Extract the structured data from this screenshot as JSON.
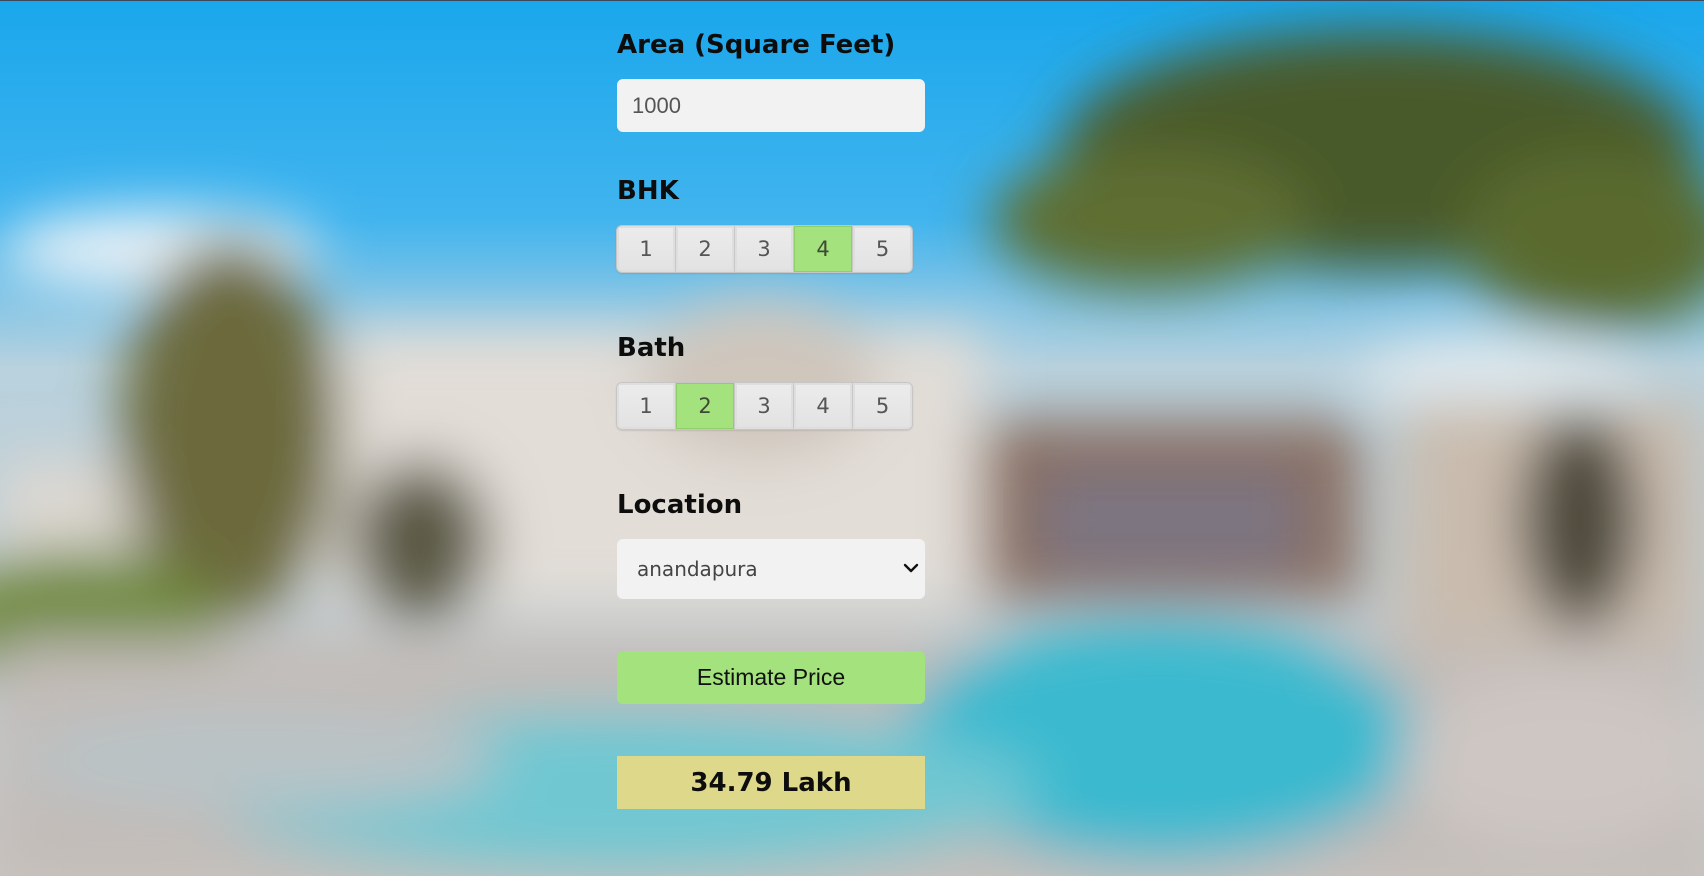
{
  "area": {
    "label": "Area (Square Feet)",
    "value": "1000"
  },
  "bhk": {
    "label": "BHK",
    "options": [
      "1",
      "2",
      "3",
      "4",
      "5"
    ],
    "selected": "4"
  },
  "bath": {
    "label": "Bath",
    "options": [
      "1",
      "2",
      "3",
      "4",
      "5"
    ],
    "selected": "2"
  },
  "location": {
    "label": "Location",
    "selected": "anandapura"
  },
  "estimate_button": {
    "label": "Estimate Price"
  },
  "result": {
    "text": "34.79 Lakh"
  },
  "colors": {
    "selected_option": "#a3e27d",
    "button": "#a3e27d",
    "result_bg": "#ded88a",
    "input_bg": "#f2f2f2"
  },
  "icons": {
    "select_arrow": "chevron-down-icon"
  }
}
